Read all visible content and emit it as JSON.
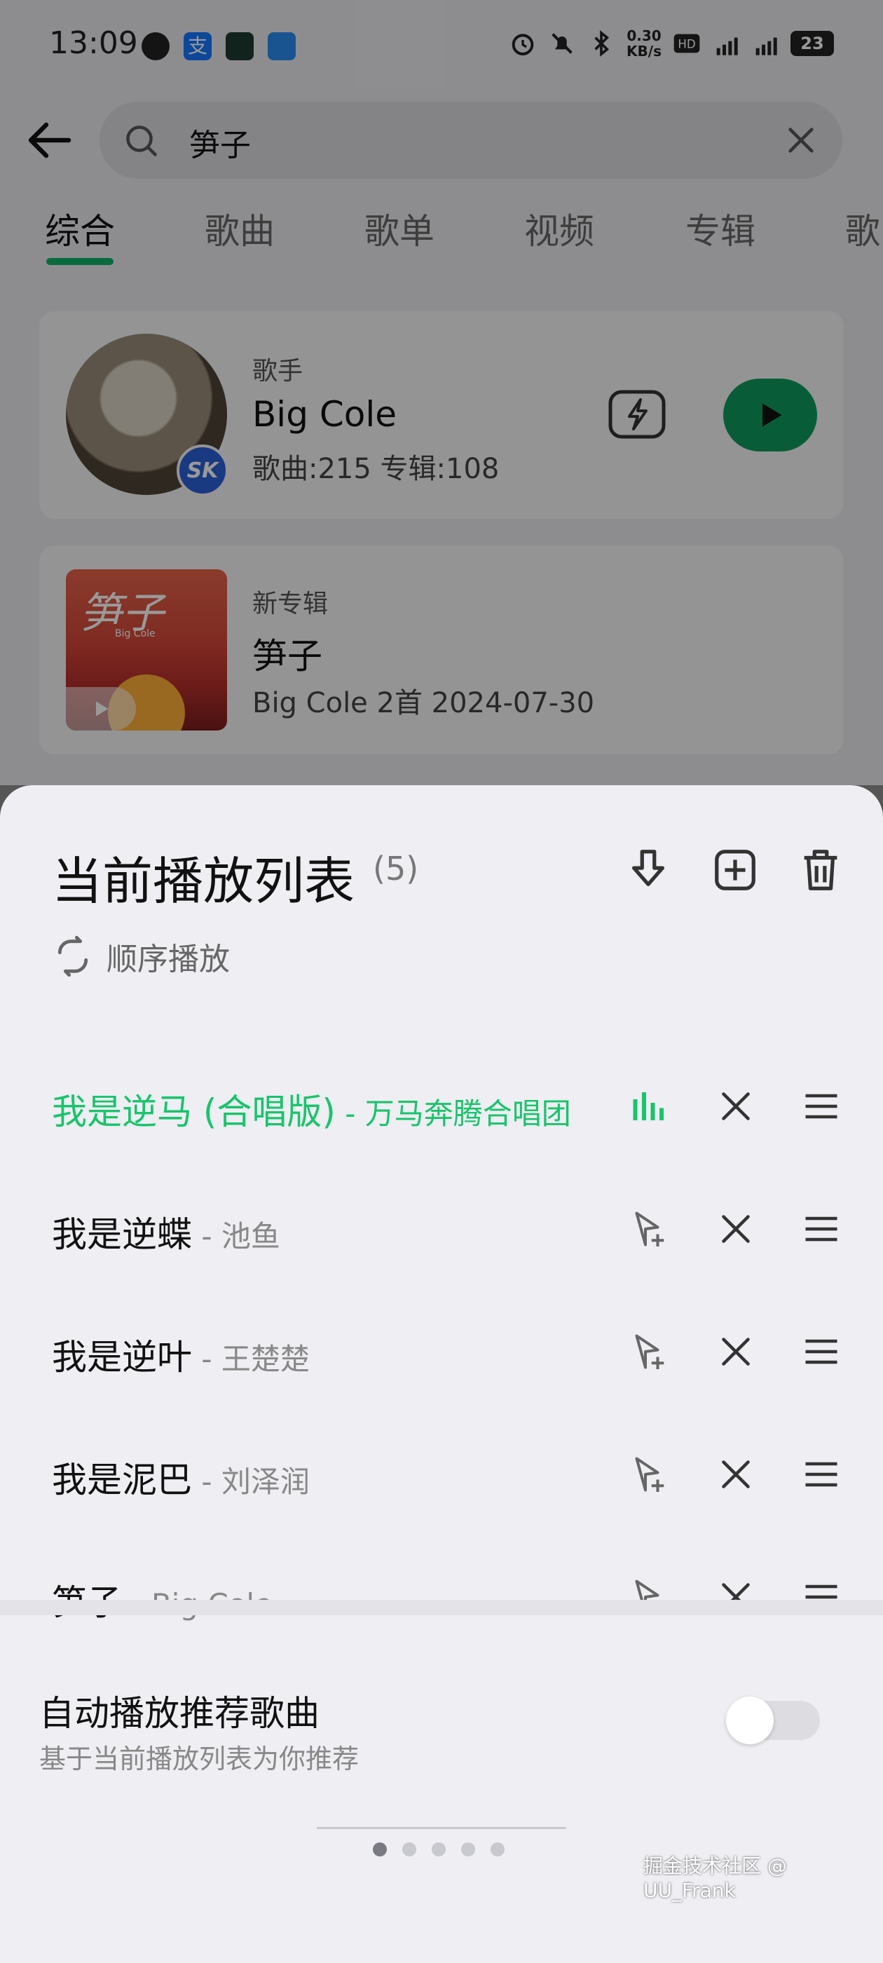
{
  "status_bar": {
    "time": "13:09",
    "net_speed_value": "0.30",
    "net_speed_unit": "KB/s",
    "battery": "23",
    "app_icons": [
      "browser-icon",
      "alipay-icon",
      "app-icon",
      "app-icon"
    ],
    "indicator_icons": [
      "alarm-icon",
      "mute-icon",
      "bluetooth-icon",
      "hd-icon",
      "signal-4g-icon",
      "signal-5g-icon"
    ]
  },
  "search": {
    "query": "笋子"
  },
  "tabs": [
    {
      "label": "综合",
      "active": true
    },
    {
      "label": "歌曲",
      "active": false
    },
    {
      "label": "歌单",
      "active": false
    },
    {
      "label": "视频",
      "active": false
    },
    {
      "label": "专辑",
      "active": false
    },
    {
      "label": "歌",
      "active": false
    }
  ],
  "artist_card": {
    "kind": "歌手",
    "name": "Big Cole",
    "stats": "歌曲:215 专辑:108",
    "badge": "SK"
  },
  "album_card": {
    "kind": "新专辑",
    "title": "笋子",
    "meta": "Big Cole  2首  2024-07-30",
    "cover_title": "笋子",
    "cover_artist": "Big Cole"
  },
  "playlist_sheet": {
    "title": "当前播放列表",
    "count": "(5)",
    "order_mode": "顺序播放",
    "songs": [
      {
        "title": "我是逆马 (合唱版)",
        "sep": " - ",
        "artist": "万马奔腾合唱团",
        "playing": true
      },
      {
        "title": "我是逆蝶",
        "sep": " - ",
        "artist": "池鱼",
        "playing": false
      },
      {
        "title": "我是逆叶",
        "sep": " - ",
        "artist": "王楚楚",
        "playing": false
      },
      {
        "title": "我是泥巴",
        "sep": " - ",
        "artist": "刘泽润",
        "playing": false
      },
      {
        "title": "笋子",
        "sep": " - ",
        "artist": "Big Cole",
        "playing": false
      }
    ],
    "autoplay_title": "自动播放推荐歌曲",
    "autoplay_subtitle": "基于当前播放列表为你推荐",
    "autoplay_enabled": false,
    "page_count": 5,
    "page_index": 0
  },
  "watermark": "掘金技术社区 @ UU_Frank",
  "colors": {
    "accent_green": "#19c46c",
    "play_green": "#0e9b5e"
  }
}
